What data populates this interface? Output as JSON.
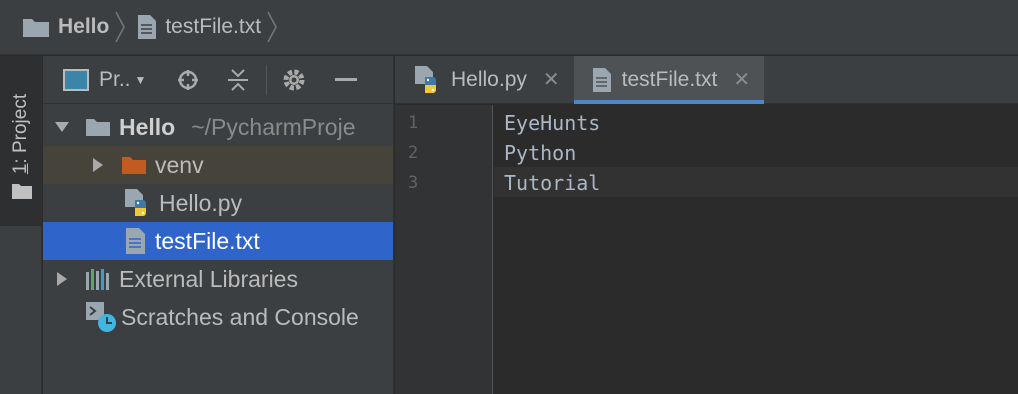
{
  "breadcrumb": {
    "project": "Hello",
    "file": "testFile.txt"
  },
  "toolwindow": {
    "number": "1",
    "label": ": Project"
  },
  "project_panel": {
    "title": "Pr..",
    "tree": [
      {
        "label": "Hello",
        "path": "~/PycharmProje",
        "icon": "folder-icon",
        "expanded": true
      },
      {
        "label": "venv",
        "icon": "folder-orange-icon",
        "expanded": false
      },
      {
        "label": "Hello.py",
        "icon": "python-file-icon"
      },
      {
        "label": "testFile.txt",
        "icon": "text-file-icon",
        "selected": true
      },
      {
        "label": "External Libraries",
        "icon": "libraries-icon",
        "expanded": false
      },
      {
        "label": "Scratches and Console",
        "icon": "scratches-icon"
      }
    ]
  },
  "tabs": [
    {
      "label": "Hello.py",
      "icon": "python-file-icon",
      "active": false
    },
    {
      "label": "testFile.txt",
      "icon": "text-file-icon",
      "active": true
    }
  ],
  "editor": {
    "line_numbers": [
      "1",
      "2",
      "3"
    ],
    "lines": [
      "EyeHunts",
      "Python",
      "Tutorial"
    ],
    "caret_line": 3
  },
  "colors": {
    "selection": "#2f65ca",
    "accent_tab": "#4a88c7",
    "code_text": "#a9b7c6",
    "folder_orange": "#c35a1f"
  }
}
